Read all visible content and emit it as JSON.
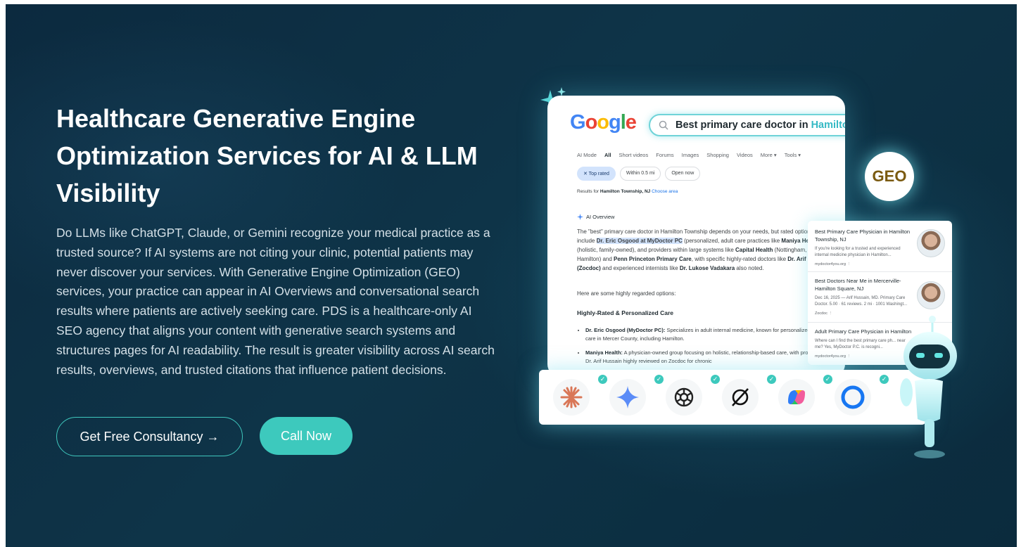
{
  "hero": {
    "title": "Healthcare Generative Engine Optimization Services for AI & LLM Visibility",
    "description": "Do LLMs like ChatGPT, Claude, or Gemini recognize your medical practice as a trusted source? If AI systems are not citing your clinic, potential patients may never discover your services. With Generative Engine Optimization (GEO) services, your practice can appear in AI Overviews and conversational search results where patients are actively seeking care. PDS is a healthcare-only AI SEO agency that aligns your content with generative search systems and structures pages for AI readability. The result is greater visibility across AI search results, overviews, and trusted citations that influence patient decisions.",
    "cta_primary": "Get Free Consultancy →",
    "cta_secondary": "Call Now"
  },
  "mock": {
    "logo": "Google",
    "search_query": "Best primary care doctor in",
    "search_highlight": "Hamilton",
    "tabs": [
      "AI Mode",
      "All",
      "Short videos",
      "Forums",
      "Images",
      "Shopping",
      "Videos",
      "More ▾",
      "Tools ▾"
    ],
    "chips": [
      "✕ Top rated",
      "Within 0.5 mi",
      "Open now"
    ],
    "results_prefix": "Results for",
    "results_location": "Hamilton Township, NJ",
    "results_link": "Choose area",
    "ai_overview_label": "AI Overview",
    "overview_parts": {
      "p1": "The \"best\" primary care doctor in Hamilton Township depends on your needs, but",
      "p2": "rated options include",
      "doc1": "Dr. Eric Osgood at MyDoctor PC",
      "p3": "(personalized, adult care",
      "p4": "practices like",
      "org1": "Maniya Health",
      "p5": "(holistic, family-owned), and providers within large",
      "p6": "systems like",
      "org2": "Capital Health",
      "p7": "(Nottingham, Hamilton) and",
      "org3": "Penn Princeton Primary Care",
      "p8": ", with specific highly-rated doctors like",
      "doc2": "Dr. Arif Hussain (Zocdoc)",
      "p9": "and",
      "p10": "experienced internists like",
      "doc3": "Dr. Lukose Vadakara",
      "p11": "also noted."
    },
    "regarded": "Here are some highly regarded options:",
    "section_heading": "Highly-Rated & Personalized Care",
    "bullets": [
      {
        "name": "Dr. Eric Osgood (MyDoctor PC):",
        "text": "Specializes in adult internal medicine, known for personalized, accessible care in Mercer County, including Hamilton."
      },
      {
        "name": "Maniya Health:",
        "text": "A physician-owned group focusing on holistic, relationship-based care, with providers like Dr. Arif Hussain highly reviewed on Zocdoc for chronic"
      }
    ],
    "side_results": [
      {
        "title": "Best Primary Care Physician in Hamilton Township, NJ",
        "snippet": "If you're looking for a trusted and experienced internal medicine physician in Hamilton...",
        "source": "mydoctor4you.org ⋮"
      },
      {
        "title": "Best Doctors Near Me in Mercerville-Hamilton Square, NJ",
        "snippet": "Dec 16, 2025 — Arif Hussain, MD. Primary Care Doctor. 5.00 · 61 reviews. 2 mi · 1001 Washingt...",
        "source": "Zocdoc ⋮"
      },
      {
        "title": "Adult Primary Care Physician in Hamilton",
        "snippet": "Where can I find the best primary care ph... near me? Yes, MyDoctor P.C. is recogni...",
        "source": "mydoctor4you.org ⋮"
      }
    ],
    "geo_badge": "GEO",
    "ai_icons": [
      "claude-icon",
      "gemini-icon",
      "chatgpt-icon",
      "grok-icon",
      "copilot-icon",
      "meta-ai-icon"
    ]
  },
  "colors": {
    "accent": "#3dc9bd",
    "background": "#0e3448",
    "highlight": "#35b9c4"
  }
}
